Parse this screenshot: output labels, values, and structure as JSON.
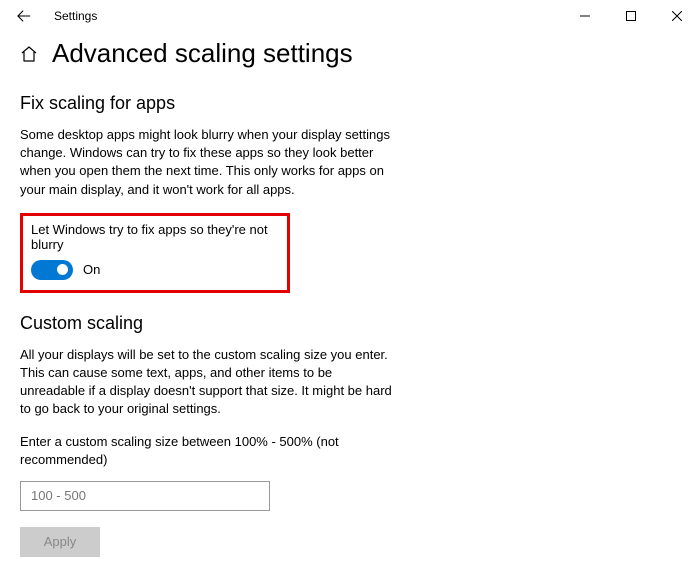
{
  "titlebar": {
    "app_name": "Settings"
  },
  "page": {
    "title": "Advanced scaling settings"
  },
  "fix_scaling": {
    "heading": "Fix scaling for apps",
    "description": "Some desktop apps might look blurry when your display settings change. Windows can try to fix these apps so they look better when you open them the next time. This only works for apps on your main display, and it won't work for all apps.",
    "toggle_label": "Let Windows try to fix apps so they're not blurry",
    "toggle_state": "On"
  },
  "custom_scaling": {
    "heading": "Custom scaling",
    "description": "All your displays will be set to the custom scaling size you enter. This can cause some text, apps, and other items to be unreadable if a display doesn't support that size. It might be hard to go back to your original settings.",
    "input_label": "Enter a custom scaling size between 100% - 500% (not recommended)",
    "input_placeholder": "100 - 500",
    "apply_label": "Apply"
  }
}
